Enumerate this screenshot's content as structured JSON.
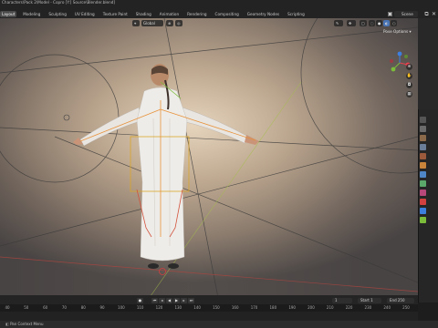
{
  "window": {
    "title": "Characters\\Pack 2\\Model - Copro [Y:] Source\\Blender.blend]"
  },
  "menu": {
    "tabs": [
      "Layout",
      "Modeling",
      "Sculpting",
      "UV Editing",
      "Texture Paint",
      "Shading",
      "Animation",
      "Rendering",
      "Compositing",
      "Geometry Nodes",
      "Scripting"
    ],
    "active_index": 0
  },
  "topbar": {
    "scene_label": "Scene"
  },
  "viewport": {
    "orientation_label": "Global",
    "pose_options_label": "Pose Options"
  },
  "timeline": {
    "current_frame": "1",
    "start_label": "Start",
    "start_value": "1",
    "end_label": "End",
    "end_value": "250",
    "ruler_ticks": [
      "40",
      "50",
      "60",
      "70",
      "80",
      "90",
      "100",
      "110",
      "120",
      "130",
      "140",
      "150",
      "160",
      "170",
      "180",
      "190",
      "200",
      "210",
      "220",
      "230",
      "240",
      "250"
    ]
  },
  "statusbar": {
    "item": "Pan Context Menu"
  },
  "colors": {
    "accent_blue": "#4772b3",
    "axis_x": "#e8424f",
    "axis_y": "#7bbd3b",
    "axis_z": "#3d7fde",
    "bone_orange": "#e8923a"
  },
  "icons": [
    "search-icon",
    "gear-icon",
    "play-icon",
    "record-icon",
    "hand-icon",
    "zoom-icon",
    "camera-icon",
    "grid-icon"
  ]
}
